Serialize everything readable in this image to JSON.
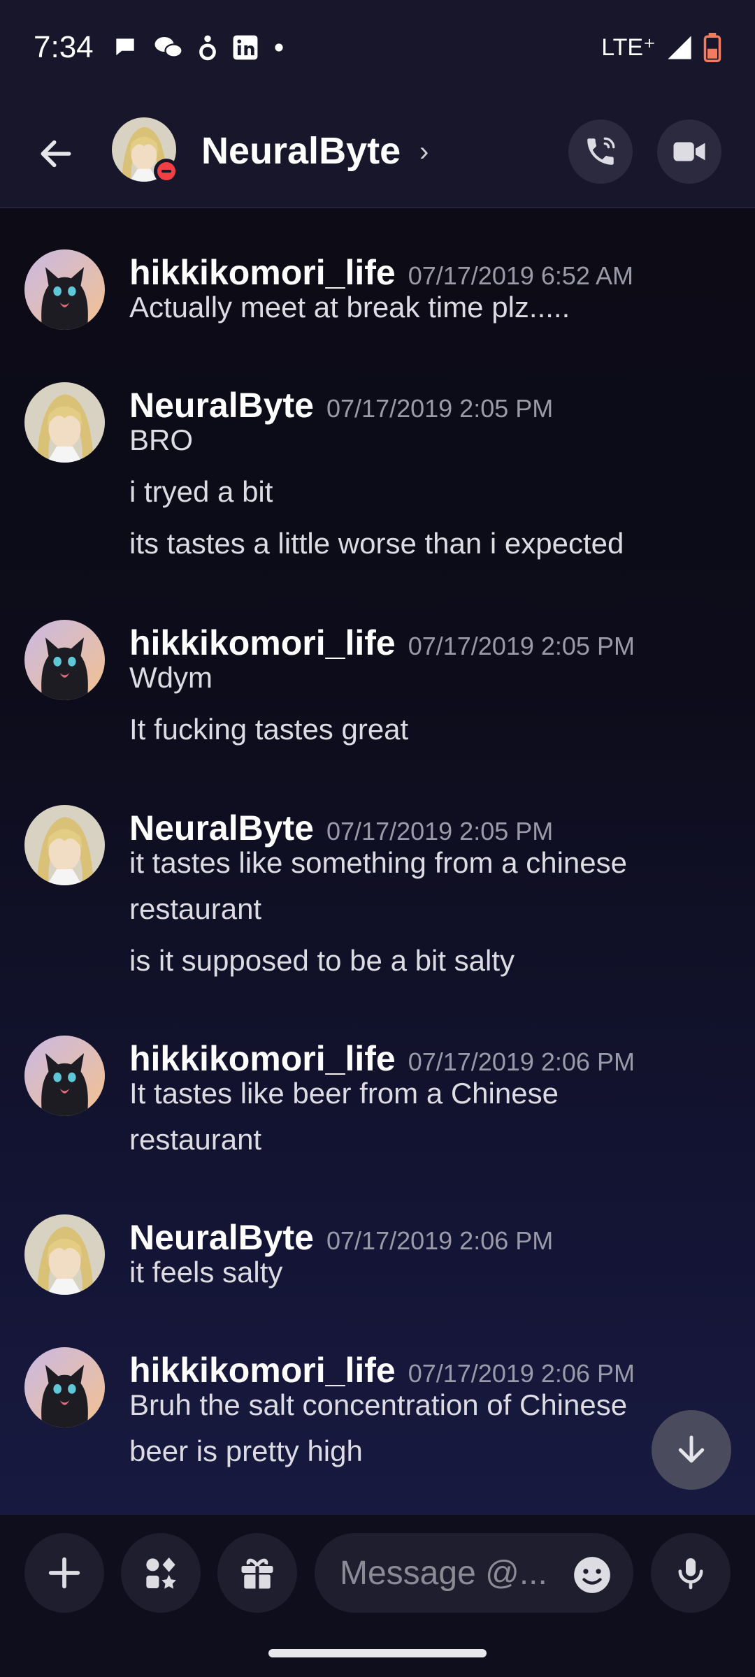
{
  "status_bar": {
    "time": "7:34",
    "network": "LTE⁺"
  },
  "header": {
    "title": "NeuralByte",
    "chevron": "›",
    "status": "do-not-disturb"
  },
  "messages": [
    {
      "author": "hikkikomori_life",
      "timestamp": "07/17/2019 6:52 AM",
      "avatar": "black-cat-avatar",
      "lines": [
        "Actually meet at break time plz....."
      ]
    },
    {
      "author": "NeuralByte",
      "timestamp": "07/17/2019 2:05 PM",
      "avatar": "blonde-anime-avatar",
      "lines": [
        "BRO",
        "i tryed a bit",
        "its tastes a little worse than i expected"
      ]
    },
    {
      "author": "hikkikomori_life",
      "timestamp": "07/17/2019 2:05 PM",
      "avatar": "black-cat-avatar",
      "lines": [
        "Wdym",
        "It fucking tastes great"
      ]
    },
    {
      "author": "NeuralByte",
      "timestamp": "07/17/2019 2:05 PM",
      "avatar": "blonde-anime-avatar",
      "lines": [
        "it tastes like something from a chinese",
        "restaurant",
        "is it supposed to be a bit salty"
      ]
    },
    {
      "author": "hikkikomori_life",
      "timestamp": "07/17/2019 2:06 PM",
      "avatar": "black-cat-avatar",
      "lines": [
        "It tastes like beer from a Chinese",
        "restaurant"
      ]
    },
    {
      "author": "NeuralByte",
      "timestamp": "07/17/2019 2:06 PM",
      "avatar": "blonde-anime-avatar",
      "lines": [
        "it feels salty"
      ]
    },
    {
      "author": "hikkikomori_life",
      "timestamp": "07/17/2019 2:06 PM",
      "avatar": "black-cat-avatar",
      "lines": [
        "Bruh the salt concentration of Chinese",
        "beer is pretty high"
      ]
    }
  ],
  "composer": {
    "placeholder": "Message @..."
  },
  "icons": [
    "back-arrow-icon",
    "phone-icon",
    "video-camera-icon",
    "plus-icon",
    "apps-icon",
    "gift-icon",
    "emoji-icon",
    "microphone-icon",
    "arrow-down-icon"
  ],
  "colors": {
    "background": "#0b0a14",
    "header": "#17162a",
    "dnd": "#f23f43",
    "button": "#1f1e2e"
  }
}
